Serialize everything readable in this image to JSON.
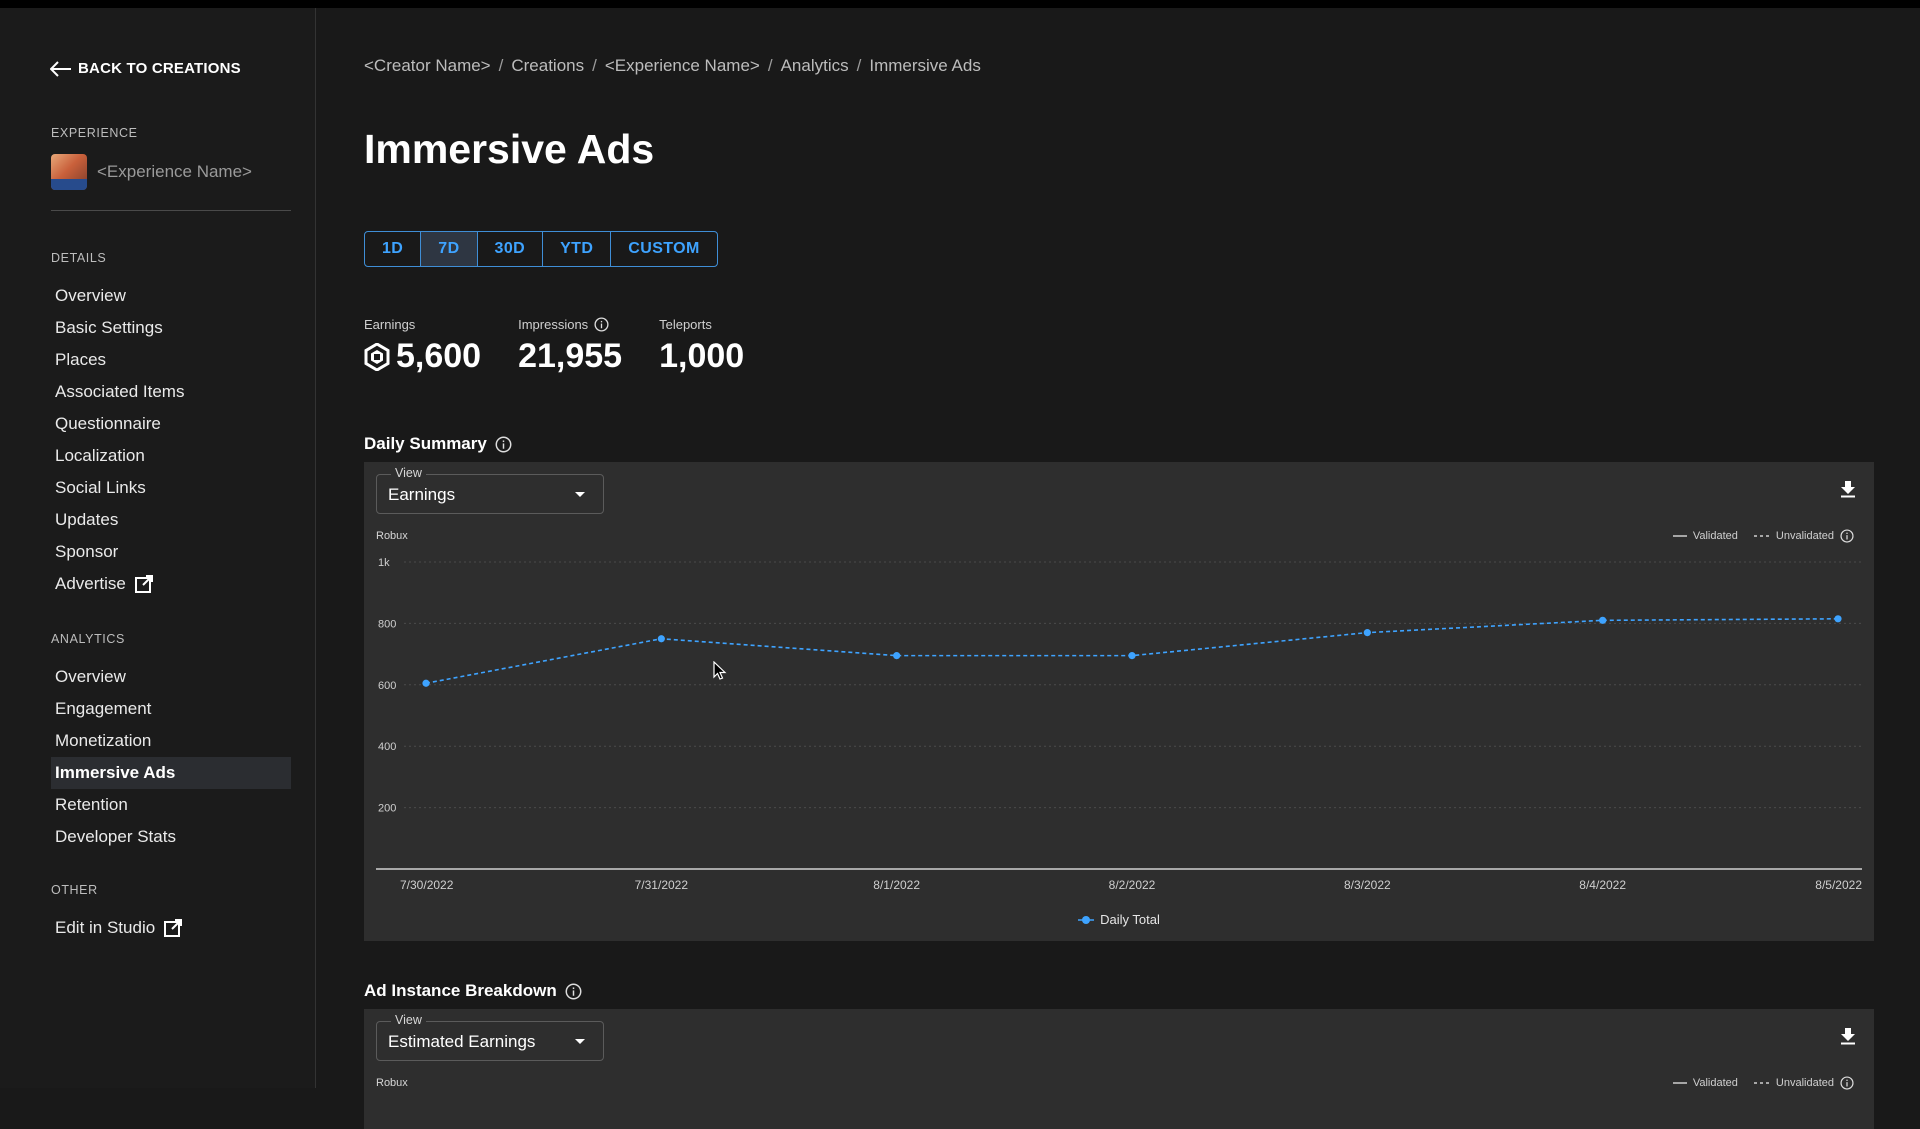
{
  "sidebar": {
    "back_label": "BACK TO CREATIONS",
    "experience_label": "EXPERIENCE",
    "experience_name": "<Experience Name>",
    "details_label": "DETAILS",
    "details_items": [
      {
        "label": "Overview"
      },
      {
        "label": "Basic Settings"
      },
      {
        "label": "Places"
      },
      {
        "label": "Associated Items"
      },
      {
        "label": "Questionnaire"
      },
      {
        "label": "Localization"
      },
      {
        "label": "Social Links"
      },
      {
        "label": "Updates"
      },
      {
        "label": "Sponsor"
      },
      {
        "label": "Advertise",
        "external": true
      }
    ],
    "analytics_label": "ANALYTICS",
    "analytics_items": [
      {
        "label": "Overview"
      },
      {
        "label": "Engagement"
      },
      {
        "label": "Monetization"
      },
      {
        "label": "Immersive Ads",
        "active": true
      },
      {
        "label": "Retention"
      },
      {
        "label": "Developer Stats"
      }
    ],
    "other_label": "OTHER",
    "other_items": [
      {
        "label": "Edit in Studio",
        "external": true
      }
    ]
  },
  "breadcrumb": [
    "<Creator Name>",
    "Creations",
    "<Experience Name>",
    "Analytics",
    "Immersive Ads"
  ],
  "page_title": "Immersive Ads",
  "date_ranges": {
    "options": [
      "1D",
      "7D",
      "30D",
      "YTD",
      "CUSTOM"
    ],
    "selected": "7D"
  },
  "stats": {
    "earnings": {
      "label": "Earnings",
      "value": "5,600",
      "icon": "robux-icon"
    },
    "impressions": {
      "label": "Impressions",
      "value": "21,955",
      "icon": "info-icon"
    },
    "teleports": {
      "label": "Teleports",
      "value": "1,000"
    }
  },
  "daily_summary": {
    "title": "Daily Summary",
    "view_label": "View",
    "view_value": "Earnings",
    "unit": "Robux",
    "legend_validated": "Validated",
    "legend_unvalidated": "Unvalidated",
    "series_legend": "Daily Total"
  },
  "ad_breakdown": {
    "title": "Ad Instance Breakdown",
    "view_label": "View",
    "view_value": "Estimated Earnings",
    "unit": "Robux",
    "legend_validated": "Validated",
    "legend_unvalidated": "Unvalidated"
  },
  "colors": {
    "accent": "#3ea3ff",
    "background": "#191919",
    "panel": "#2e2e2e"
  },
  "chart_data": {
    "type": "line",
    "title": "",
    "xlabel": "",
    "ylabel": "Robux",
    "x": [
      "7/30/2022",
      "7/31/2022",
      "8/1/2022",
      "8/2/2022",
      "8/3/2022",
      "8/4/2022",
      "8/5/2022"
    ],
    "series": [
      {
        "name": "Daily Total",
        "values": [
          605,
          750,
          695,
          695,
          770,
          810,
          815
        ],
        "style": "dashed",
        "color": "#3ea3ff"
      }
    ],
    "yticks": [
      200,
      400,
      600,
      800,
      1000
    ],
    "ytick_labels": [
      "200",
      "400",
      "600",
      "800",
      "1k"
    ],
    "ylim": [
      0,
      1000
    ],
    "grid": true,
    "legend": "bottom-center"
  }
}
